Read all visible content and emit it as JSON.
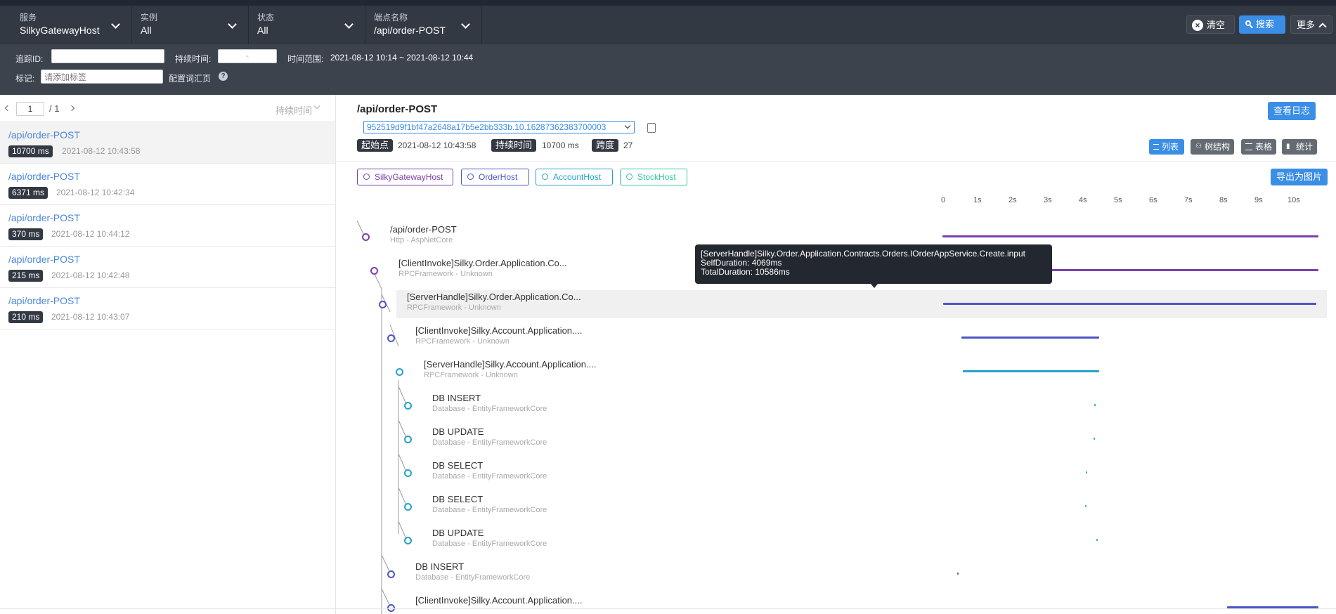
{
  "filters": {
    "service": {
      "label": "服务",
      "value": "SilkyGatewayHost"
    },
    "instance": {
      "label": "实例",
      "value": "All"
    },
    "status": {
      "label": "状态",
      "value": "All"
    },
    "endpoint": {
      "label": "端点名称",
      "value": "/api/order-POST"
    }
  },
  "actions": {
    "clear": "清空",
    "search": "搜索",
    "more": "更多"
  },
  "search": {
    "trace_id_label": "追踪ID:",
    "duration_label": "持续时间:",
    "duration_sep": "-",
    "time_range_label": "时间范围:",
    "time_range_value": "2021-08-12 10:14 ~ 2021-08-12 10:44",
    "tag_label": "标记:",
    "tag_placeholder": "请添加标签",
    "config_link": "配置词汇页"
  },
  "pager": {
    "page": "1",
    "total": "/ 1",
    "sort": "持续时间"
  },
  "trace_list": [
    {
      "title": "/api/order-POST",
      "duration": "10700 ms",
      "time": "2021-08-12 10:43:58"
    },
    {
      "title": "/api/order-POST",
      "duration": "6371 ms",
      "time": "2021-08-12 10:42:34"
    },
    {
      "title": "/api/order-POST",
      "duration": "370 ms",
      "time": "2021-08-12 10:44:12"
    },
    {
      "title": "/api/order-POST",
      "duration": "215 ms",
      "time": "2021-08-12 10:42:48"
    },
    {
      "title": "/api/order-POST",
      "duration": "210 ms",
      "time": "2021-08-12 10:43:07"
    }
  ],
  "detail": {
    "title": "/api/order-POST",
    "trace_id": "952519d9f1bf47a2648a17b5e2bb333b.10.16287362383700003",
    "start_label": "起始点",
    "start_value": "2021-08-12 10:43:58",
    "duration_label": "持续时间",
    "duration_value": "10700 ms",
    "span_label": "跨度",
    "span_value": "27",
    "view_log": "查看日志",
    "export": "导出为图片",
    "views": {
      "list": "列表",
      "tree": "树结构",
      "table": "表格",
      "stats": "统计"
    }
  },
  "hosts": [
    {
      "name": "SilkyGatewayHost",
      "color": "#7c3fae"
    },
    {
      "name": "OrderHost",
      "color": "#4b56c6"
    },
    {
      "name": "AccountHost",
      "color": "#23a3c9"
    },
    {
      "name": "StockHost",
      "color": "#2fc99a"
    }
  ],
  "axis_ticks": [
    "0",
    "1s",
    "2s",
    "3s",
    "4s",
    "5s",
    "6s",
    "7s",
    "8s",
    "9s",
    "10s"
  ],
  "spans": [
    {
      "name": "/api/order-POST",
      "sub": "Http - AspNetCore"
    },
    {
      "name": "[ClientInvoke]Silky.Order.Application.Co...",
      "sub": "RPCFramework - Unknown"
    },
    {
      "name": "[ServerHandle]Silky.Order.Application.Co...",
      "sub": "RPCFramework - Unknown"
    },
    {
      "name": "[ClientInvoke]Silky.Account.Application....",
      "sub": "RPCFramework - Unknown"
    },
    {
      "name": "[ServerHandle]Silky.Account.Application....",
      "sub": "RPCFramework - Unknown"
    },
    {
      "name": "DB INSERT",
      "sub": "Database - EntityFrameworkCore"
    },
    {
      "name": "DB UPDATE",
      "sub": "Database - EntityFrameworkCore"
    },
    {
      "name": "DB SELECT",
      "sub": "Database - EntityFrameworkCore"
    },
    {
      "name": "DB SELECT",
      "sub": "Database - EntityFrameworkCore"
    },
    {
      "name": "DB UPDATE",
      "sub": "Database - EntityFrameworkCore"
    },
    {
      "name": "DB INSERT",
      "sub": "Database - EntityFrameworkCore"
    },
    {
      "name": "[ClientInvoke]Silky.Account.Application....",
      "sub": ""
    }
  ],
  "tooltip": {
    "line1": "[ServerHandle]Silky.Order.Application.Contracts.Orders.IOrderAppService.Create.input",
    "line2": "SelfDuration: 4069ms",
    "line3": "TotalDuration: 10586ms"
  }
}
